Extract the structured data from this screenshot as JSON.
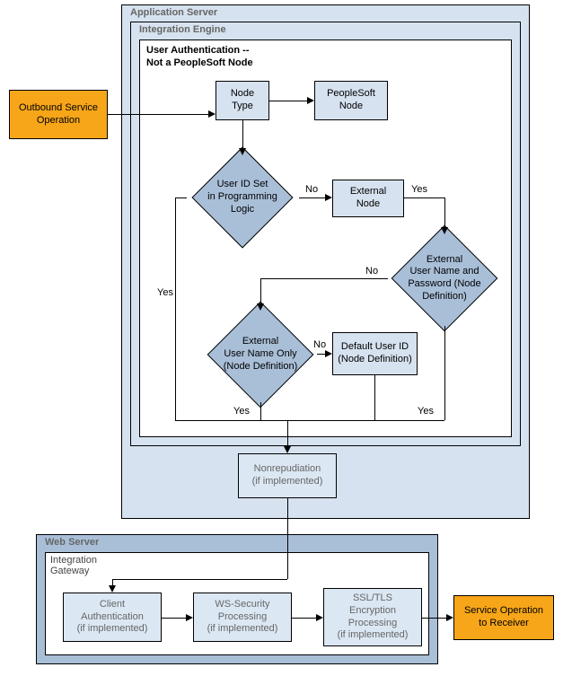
{
  "containers": {
    "app_server": "Application Server",
    "integration_engine": "Integration Engine",
    "user_auth_box": "User Authentication --\nNot a PeopleSoft Node",
    "web_server": "Web Server",
    "integration_gateway": "Integration\nGateway"
  },
  "nodes": {
    "outbound": "Outbound Service Operation",
    "node_type": "Node\nType",
    "peoplesoft_node": "PeopleSoft\nNode",
    "userid_set": "User ID Set\nin Programming\nLogic",
    "external_node": "External\nNode",
    "ext_un_pw": "External\nUser Name and\nPassword (Node\nDefinition)",
    "ext_un_only": "External\nUser Name Only\n(Node Definition)",
    "default_userid": "Default User ID\n(Node Definition)",
    "nonrepudiation": "Nonrepudiation\n(if implemented)",
    "client_auth": "Client\nAuthentication\n(if implemented)",
    "ws_security": "WS-Security\nProcessing\n(if implemented)",
    "ssl_tls": "SSL/TLS\nEncryption\nProcessing\n(if implemented)",
    "receiver": "Service Operation\nto Receiver"
  },
  "edges": {
    "yes": "Yes",
    "no": "No"
  },
  "chart_data": {
    "type": "flowchart",
    "containers": [
      {
        "id": "app_server",
        "label": "Application Server",
        "children": [
          "integration_engine",
          "nonrepudiation"
        ]
      },
      {
        "id": "integration_engine",
        "label": "Integration Engine",
        "children": [
          "user_auth_box"
        ]
      },
      {
        "id": "user_auth_box",
        "label": "User Authentication -- Not a PeopleSoft Node",
        "children": [
          "node_type",
          "peoplesoft_node",
          "userid_set",
          "external_node",
          "ext_un_pw",
          "ext_un_only",
          "default_userid"
        ]
      },
      {
        "id": "web_server",
        "label": "Web Server",
        "children": [
          "integration_gateway"
        ]
      },
      {
        "id": "integration_gateway",
        "label": "Integration Gateway",
        "children": [
          "client_auth",
          "ws_security",
          "ssl_tls"
        ]
      }
    ],
    "nodes": [
      {
        "id": "outbound",
        "label": "Outbound Service Operation",
        "shape": "rect"
      },
      {
        "id": "node_type",
        "label": "Node Type",
        "shape": "rect"
      },
      {
        "id": "peoplesoft_node",
        "label": "PeopleSoft Node",
        "shape": "rect"
      },
      {
        "id": "userid_set",
        "label": "User ID Set in Programming Logic",
        "shape": "decision"
      },
      {
        "id": "external_node",
        "label": "External Node",
        "shape": "rect"
      },
      {
        "id": "ext_un_pw",
        "label": "External User Name and Password (Node Definition)",
        "shape": "decision"
      },
      {
        "id": "ext_un_only",
        "label": "External User Name Only (Node Definition)",
        "shape": "decision"
      },
      {
        "id": "default_userid",
        "label": "Default User ID (Node Definition)",
        "shape": "rect"
      },
      {
        "id": "nonrepudiation",
        "label": "Nonrepudiation (if implemented)",
        "shape": "rect"
      },
      {
        "id": "client_auth",
        "label": "Client Authentication (if implemented)",
        "shape": "rect"
      },
      {
        "id": "ws_security",
        "label": "WS-Security Processing (if implemented)",
        "shape": "rect"
      },
      {
        "id": "ssl_tls",
        "label": "SSL/TLS Encryption Processing (if implemented)",
        "shape": "rect"
      },
      {
        "id": "receiver",
        "label": "Service Operation to Receiver",
        "shape": "rect"
      }
    ],
    "edges": [
      {
        "from": "outbound",
        "to": "node_type"
      },
      {
        "from": "node_type",
        "to": "peoplesoft_node"
      },
      {
        "from": "node_type",
        "to": "userid_set"
      },
      {
        "from": "userid_set",
        "to": "external_node",
        "label": "No"
      },
      {
        "from": "userid_set",
        "to": "nonrepudiation",
        "label": "Yes"
      },
      {
        "from": "external_node",
        "to": "ext_un_pw",
        "label": "Yes"
      },
      {
        "from": "ext_un_pw",
        "to": "ext_un_only",
        "label": "No"
      },
      {
        "from": "ext_un_pw",
        "to": "nonrepudiation",
        "label": "Yes"
      },
      {
        "from": "ext_un_only",
        "to": "default_userid",
        "label": "No"
      },
      {
        "from": "ext_un_only",
        "to": "nonrepudiation",
        "label": "Yes"
      },
      {
        "from": "default_userid",
        "to": "nonrepudiation"
      },
      {
        "from": "nonrepudiation",
        "to": "client_auth"
      },
      {
        "from": "client_auth",
        "to": "ws_security"
      },
      {
        "from": "ws_security",
        "to": "ssl_tls"
      },
      {
        "from": "ssl_tls",
        "to": "receiver"
      }
    ]
  }
}
